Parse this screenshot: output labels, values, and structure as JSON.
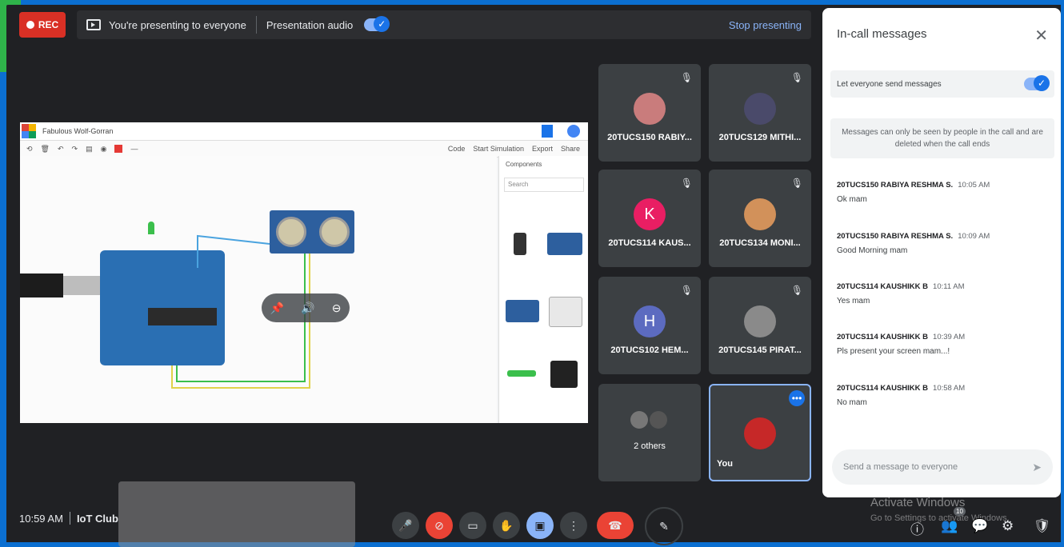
{
  "topbar": {
    "rec_label": "REC",
    "presenting_text": "You're presenting to everyone",
    "audio_label": "Presentation audio",
    "stop_label": "Stop presenting"
  },
  "shared": {
    "app_title": "Fabulous Wolf-Gorran",
    "toolbar_right": [
      "Code",
      "Start Simulation",
      "Export",
      "Share"
    ],
    "panel_heading": "Components",
    "panel_search": "Search"
  },
  "participants": [
    {
      "name": "20TUCS150 RABIY...",
      "type": "photo",
      "color": "#c97c7c"
    },
    {
      "name": "20TUCS129 MITHI...",
      "type": "photo",
      "color": "#4a4a6a"
    },
    {
      "name": "20TUCS114 KAUS...",
      "type": "initial",
      "initial": "K",
      "color": "#e91e63"
    },
    {
      "name": "20TUCS134 MONI...",
      "type": "photo",
      "color": "#d2915a"
    },
    {
      "name": "20TUCS102 HEM...",
      "type": "initial",
      "initial": "H",
      "color": "#5c6bc0"
    },
    {
      "name": "20TUCS145 PIRAT...",
      "type": "photo",
      "color": "#8a8a8a"
    },
    {
      "name": "2 others",
      "type": "group",
      "color": "#777777"
    },
    {
      "name": "You",
      "type": "self",
      "color": "#c62828"
    }
  ],
  "chat": {
    "title": "In-call messages",
    "toggle_label": "Let everyone send messages",
    "note": "Messages can only be seen by people in the call and are deleted when the call ends",
    "messages": [
      {
        "sender": "20TUCS150 RABIYA RESHMA S.",
        "time": "10:05 AM",
        "text": "Ok mam"
      },
      {
        "sender": "20TUCS150 RABIYA RESHMA S.",
        "time": "10:09 AM",
        "text": "Good Morning mam"
      },
      {
        "sender": "20TUCS114 KAUSHIKK B",
        "time": "10:11 AM",
        "text": "Yes mam"
      },
      {
        "sender": "20TUCS114 KAUSHIKK B",
        "time": "10:39 AM",
        "text": "Pls present your screen mam...!"
      },
      {
        "sender": "20TUCS114 KAUSHIKK B",
        "time": "10:58 AM",
        "text": "No mam"
      }
    ],
    "input_placeholder": "Send a message to everyone"
  },
  "footer": {
    "time": "10:59 AM",
    "meeting_name": "IoT Club",
    "people_count": "10"
  },
  "watermark": {
    "line1": "Activate Windows",
    "line2": "Go to Settings to activate Windows."
  },
  "icons": [
    "close-icon",
    "mic-off-icon",
    "camera-off-icon",
    "captions-icon",
    "raise-hand-icon",
    "present-icon",
    "more-options-icon",
    "end-call-icon",
    "info-icon",
    "people-icon",
    "chat-icon",
    "activities-icon",
    "host-controls-icon",
    "send-icon"
  ]
}
